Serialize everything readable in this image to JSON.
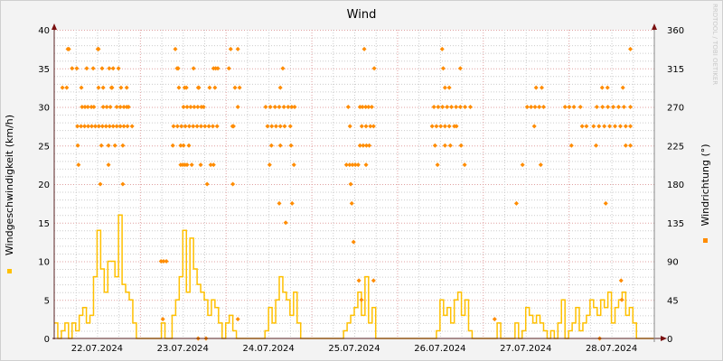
{
  "chart_data": {
    "type": "line",
    "title": "Wind",
    "ylabel": "Windgeschwindigkeit (km/h)",
    "ylabel_right": "Windrichtung (°)",
    "watermark": "RRDTOOL / TOBI OETIKER",
    "ylim": [
      0,
      40
    ],
    "ylim_right": [
      0,
      360
    ],
    "yticks": [
      "0",
      "5",
      "10",
      "15",
      "20",
      "25",
      "30",
      "35",
      "40"
    ],
    "yticks_right": [
      "0",
      "45",
      "90",
      "135",
      "180",
      "225",
      "270",
      "315",
      "360"
    ],
    "xlim_hours": [
      0,
      168
    ],
    "xticks": [
      "22.07.2024",
      "23.07.2024",
      "24.07.2024",
      "25.07.2024",
      "26.07.2024",
      "27.07.2024",
      "28.07.2024"
    ],
    "grid": true,
    "colors": {
      "speed": "#ffc000",
      "direction": "#ff8c00",
      "major_grid": "#e0a0a0",
      "minor_grid": "#cccccc",
      "axis": "#5a2020"
    },
    "series": [
      {
        "name": "Windgeschwindigkeit",
        "unit": "km/h",
        "step_hours": 1,
        "values": [
          2,
          0,
          1,
          2,
          0,
          2,
          1,
          3,
          4,
          2,
          3,
          8,
          14,
          9,
          6,
          10,
          10,
          8,
          16,
          7,
          6,
          5,
          2,
          0,
          0,
          0,
          0,
          0,
          0,
          0,
          2,
          0,
          0,
          3,
          5,
          8,
          14,
          6,
          13,
          9,
          7,
          6,
          5,
          3,
          5,
          4,
          2,
          0,
          2,
          3,
          1,
          0,
          0,
          0,
          0,
          0,
          0,
          0,
          0,
          1,
          4,
          2,
          5,
          8,
          6,
          5,
          3,
          6,
          2,
          0,
          0,
          0,
          0,
          0,
          0,
          0,
          0,
          0,
          0,
          0,
          0,
          1,
          2,
          3,
          4,
          6,
          3,
          8,
          2,
          4,
          0,
          0,
          0,
          0,
          0,
          0,
          0,
          0,
          0,
          0,
          0,
          0,
          0,
          0,
          0,
          0,
          0,
          1,
          5,
          3,
          4,
          2,
          5,
          6,
          3,
          5,
          1,
          0,
          0,
          0,
          0,
          0,
          0,
          0,
          2,
          0,
          0,
          0,
          0,
          2,
          0,
          1,
          4,
          3,
          2,
          3,
          2,
          1,
          0,
          1,
          0,
          2,
          5,
          0,
          1,
          2,
          4,
          1,
          2,
          3,
          5,
          4,
          3,
          5,
          4,
          6,
          2,
          4,
          5,
          6,
          3,
          4,
          2,
          0,
          0,
          0,
          0,
          0
        ]
      },
      {
        "name": "Windrichtung",
        "unit": "°",
        "points_by_degree": {
          "337.5": [
            3.8,
            4.1,
            12.2,
            12.4,
            33.9,
            49.4,
            51.4,
            86.8,
            108.6,
            161.3
          ],
          "315": [
            5,
            6.3,
            9.1,
            10.9,
            13.4,
            15.4,
            16.5,
            18,
            34.4,
            34.7,
            39,
            44.6,
            45.2,
            45.8,
            48.9,
            64,
            89.6,
            108.9,
            113.7
          ],
          "292.5": [
            2.3,
            3.5,
            7.6,
            12.4,
            13.7,
            16,
            16.2,
            18.7,
            20.3,
            34.9,
            36.5,
            37,
            40.3,
            40.5,
            43.5,
            45,
            50.6,
            51.9,
            63.3,
            109.4,
            110.6,
            134.9,
            136.5,
            153.4,
            154.9,
            159.2
          ],
          "270": [
            7.8,
            8.6,
            9.4,
            10.4,
            11.1,
            13.7,
            14.7,
            15.7,
            17.5,
            18.5,
            19.5,
            20.3,
            20.8,
            36.2,
            37.2,
            38.2,
            39.2,
            40.2,
            41.2,
            41.8,
            51.4,
            59.2,
            60.5,
            61.8,
            63,
            64.3,
            65.5,
            66.5,
            67.3,
            82.3,
            85.6,
            86.3,
            87.2,
            88,
            88.9,
            106.3,
            107.5,
            108.7,
            110,
            111.2,
            112.5,
            113.7,
            115,
            116.5,
            132.4,
            133.5,
            134.6,
            135.8,
            137,
            143,
            144.2,
            145.5,
            147.3,
            151.9,
            153.5,
            155,
            156.5,
            158,
            159.5,
            161.3
          ],
          "247.5": [
            6.5,
            7.5,
            8.5,
            9.5,
            10.5,
            11.5,
            12.5,
            13.5,
            14.5,
            15.5,
            16.5,
            17.5,
            18.5,
            19.5,
            20.5,
            21.8,
            33.4,
            34.5,
            35.6,
            36.7,
            37.8,
            38.9,
            40,
            41.1,
            42.2,
            43.3,
            44.4,
            45.6,
            49.9,
            50.2,
            59.7,
            60.9,
            62.1,
            63.3,
            64.5,
            66.1,
            82.8,
            86.1,
            87.3,
            88.5,
            89.4,
            105.8,
            107,
            108.2,
            109.4,
            110.6,
            112,
            112.6,
            134.4,
            147.8,
            149,
            151,
            152.5,
            154,
            155.5,
            157,
            158.5,
            160,
            161.3
          ],
          "225": [
            6.6,
            13.2,
            15.2,
            17,
            19.2,
            33.2,
            35.4,
            36.2,
            37.7,
            60.8,
            63.3,
            66.3,
            85.6,
            86.5,
            87.4,
            88.2,
            106.6,
            109.4,
            110.9,
            113.9,
            144.8,
            151.7,
            160,
            161.3
          ],
          "202.5": [
            6.8,
            15.2,
            35.4,
            36,
            36.6,
            37.2,
            38.5,
            41,
            43.8,
            44.6,
            60.3,
            67.1,
            81.8,
            82.7,
            83.5,
            84.3,
            85.1,
            87.3,
            107.3,
            114.9,
            131.1,
            136.2
          ],
          "180": [
            12.9,
            19.2,
            42.8,
            50,
            83
          ],
          "157.5": [
            63,
            66.6,
            83.3,
            129.4,
            154.4
          ],
          "135": [
            64.8
          ],
          "112.5": [
            83.8
          ],
          "90": [
            29.9,
            30.6,
            31.4
          ],
          "67.5": [
            85.3,
            89.4,
            158.7
          ],
          "45": [
            86,
            158.9
          ],
          "22.5": [
            30.4,
            51.4,
            123.3
          ],
          "0": [
            40.3,
            42.5,
            152.7
          ]
        }
      }
    ]
  }
}
